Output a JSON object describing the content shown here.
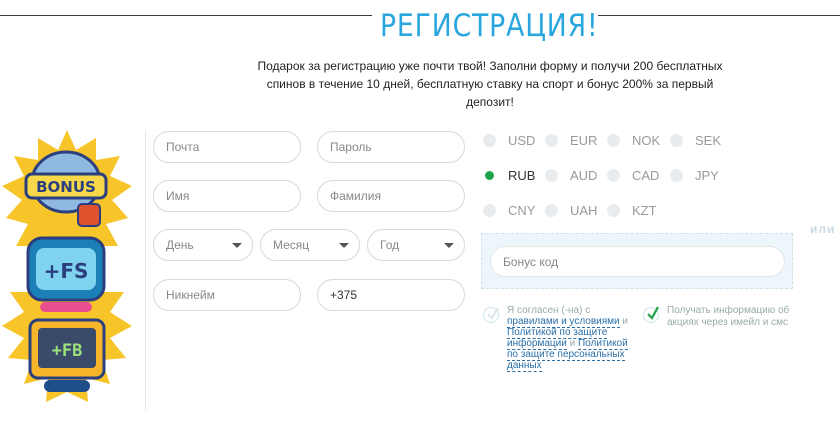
{
  "header": {
    "title": "РЕГИСТРАЦИЯ!",
    "subtitle": "Подарок за регистрацию уже почти твой! Заполни форму и получи 200 бесплатных спинов в течение 10 дней, бесплатную ставку на спорт и бонус 200% за первый депозит!"
  },
  "promo": {
    "bonus_label": "BONUS",
    "fs_label": "+FS",
    "fb_label": "+FB",
    "accent_colors": {
      "sun": "#f7c52a",
      "screen": "#2aa6df",
      "frame": "#2b3f7f"
    }
  },
  "form": {
    "email_placeholder": "Почта",
    "password_placeholder": "Пароль",
    "first_name_placeholder": "Имя",
    "last_name_placeholder": "Фамилия",
    "day_label": "День",
    "month_label": "Месяц",
    "year_label": "Год",
    "nickname_placeholder": "Никнейм",
    "phone_value": "+375"
  },
  "currencies": [
    {
      "code": "USD",
      "selected": false
    },
    {
      "code": "EUR",
      "selected": false
    },
    {
      "code": "NOK",
      "selected": false
    },
    {
      "code": "SEK",
      "selected": false
    },
    {
      "code": "RUB",
      "selected": true
    },
    {
      "code": "AUD",
      "selected": false
    },
    {
      "code": "CAD",
      "selected": false
    },
    {
      "code": "JPY",
      "selected": false
    },
    {
      "code": "CNY",
      "selected": false
    },
    {
      "code": "UAH",
      "selected": false
    },
    {
      "code": "KZT",
      "selected": false
    }
  ],
  "bonus": {
    "placeholder": "Бонус код",
    "or_label": "или"
  },
  "agreement": {
    "prefix": "Я согласен (-на) с",
    "link1": "правилами и условиями",
    "and1": " и ",
    "link2": "Политикой по защите информации",
    "and2": " и ",
    "link3": "Политикой по защите персональных данных"
  },
  "newsletter": {
    "label": "Получать информацию об акциях через имейл и смс"
  },
  "colors": {
    "accent": "#2aa6df",
    "radio_selected": "#1ea34a",
    "check": "#1ea34a"
  }
}
